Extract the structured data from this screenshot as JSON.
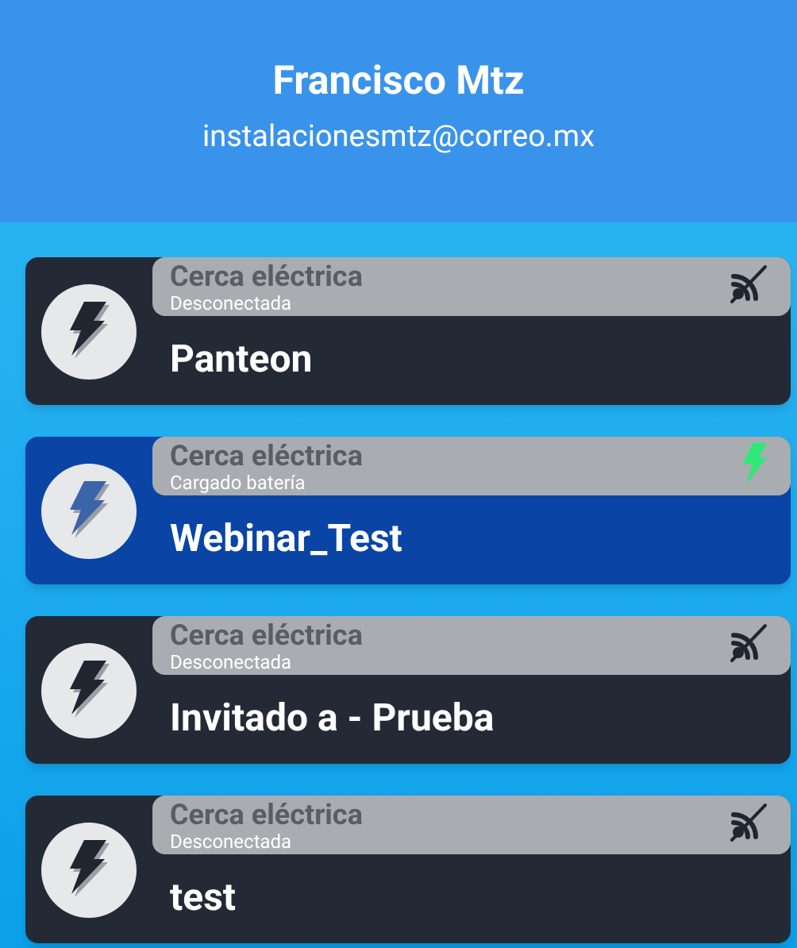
{
  "header": {
    "name": "Francisco Mtz",
    "email": "instalacionesmtz@correo.mx"
  },
  "devices": [
    {
      "type": "Cerca eléctrica",
      "status": "Desconectada",
      "name": "Panteon",
      "kind": "disconnected",
      "selected": false
    },
    {
      "type": "Cerca eléctrica",
      "status": "Cargado batería",
      "name": "Webinar_Test",
      "kind": "charging",
      "selected": true
    },
    {
      "type": "Cerca eléctrica",
      "status": "Desconectada",
      "name": "Invitado a - Prueba",
      "kind": "disconnected",
      "selected": false
    },
    {
      "type": "Cerca eléctrica",
      "status": "Desconectada",
      "name": "test",
      "kind": "disconnected",
      "selected": false
    }
  ]
}
